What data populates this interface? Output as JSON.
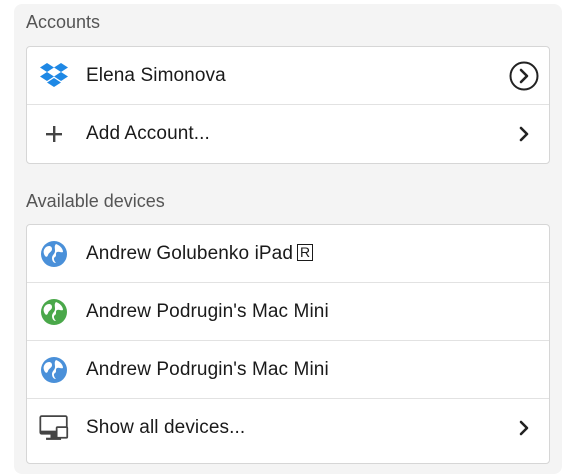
{
  "accounts": {
    "title": "Accounts",
    "items": [
      {
        "label": "Elena Simonova",
        "icon": "dropbox-icon"
      },
      {
        "label": "Add Account...",
        "icon": "plus-icon"
      }
    ]
  },
  "devices": {
    "title": "Available devices",
    "items": [
      {
        "label": "Andrew Golubenko iPad",
        "badge": "R",
        "icon": "globe-icon",
        "color": "#4a90d9"
      },
      {
        "label": "Andrew Podrugin's Mac Mini",
        "icon": "globe-icon",
        "color": "#4aa84a"
      },
      {
        "label": "Andrew Podrugin's Mac Mini",
        "icon": "globe-icon",
        "color": "#4a90d9"
      },
      {
        "label": "Show all devices...",
        "icon": "monitor-icon"
      }
    ]
  },
  "colors": {
    "dropbox": "#1e88e5",
    "globe_blue": "#4a90d9",
    "globe_green": "#4aa84a"
  }
}
